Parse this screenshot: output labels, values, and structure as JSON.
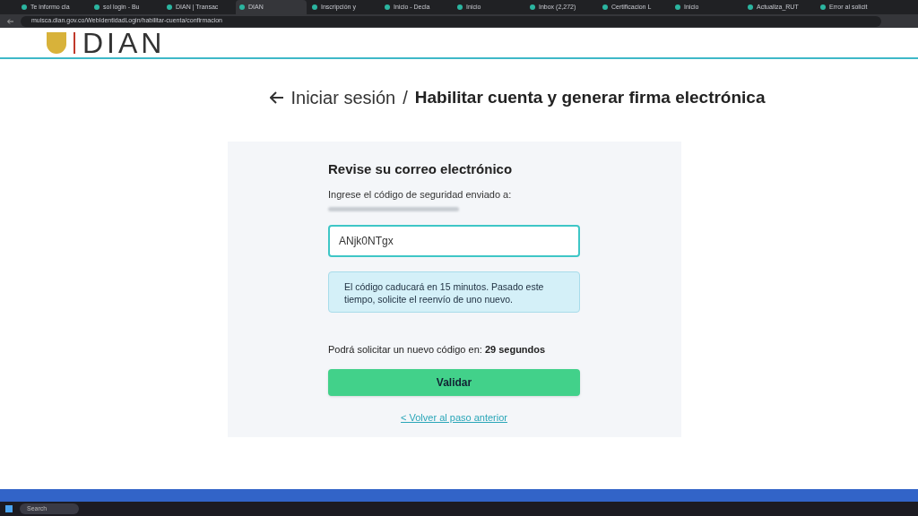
{
  "browser": {
    "tabs": [
      {
        "title": "Te informo cla",
        "selected": false
      },
      {
        "title": "sol login - Bu",
        "selected": false
      },
      {
        "title": "DIAN | Transac",
        "selected": false
      },
      {
        "title": "DIAN",
        "selected": true
      },
      {
        "title": "Inscripción y",
        "selected": false
      },
      {
        "title": "Inicio - Decla",
        "selected": false
      },
      {
        "title": "Inicio",
        "selected": false
      },
      {
        "title": "Inbox (2,272)",
        "selected": false
      },
      {
        "title": "Certificacion L",
        "selected": false
      },
      {
        "title": "Inicio",
        "selected": false
      },
      {
        "title": "Actualiza_RUT",
        "selected": false
      },
      {
        "title": "Error al solicit",
        "selected": false
      }
    ],
    "url": "muisca.dian.gov.co/WebIdentidadLogin/habilitar-cuenta/confirmacion"
  },
  "header": {
    "logo": "DIAN"
  },
  "breadcrumb": {
    "back": "Iniciar sesión",
    "separator": "/",
    "current": "Habilitar cuenta y generar firma electrónica"
  },
  "card": {
    "title": "Revise su correo electrónico",
    "instruction": "Ingrese el código de seguridad enviado a:",
    "code_field": {
      "value": "ANjk0NTgx"
    },
    "notice": "El código caducará en 15 minutos. Pasado este tiempo, solicite el reenvío de uno nuevo.",
    "resend": "Podrá solicitar un nuevo código en: **29 segundos**",
    "submit": "Validar",
    "back_link": "< Volver al paso anterior"
  },
  "taskbar": {
    "search": "Search"
  }
}
